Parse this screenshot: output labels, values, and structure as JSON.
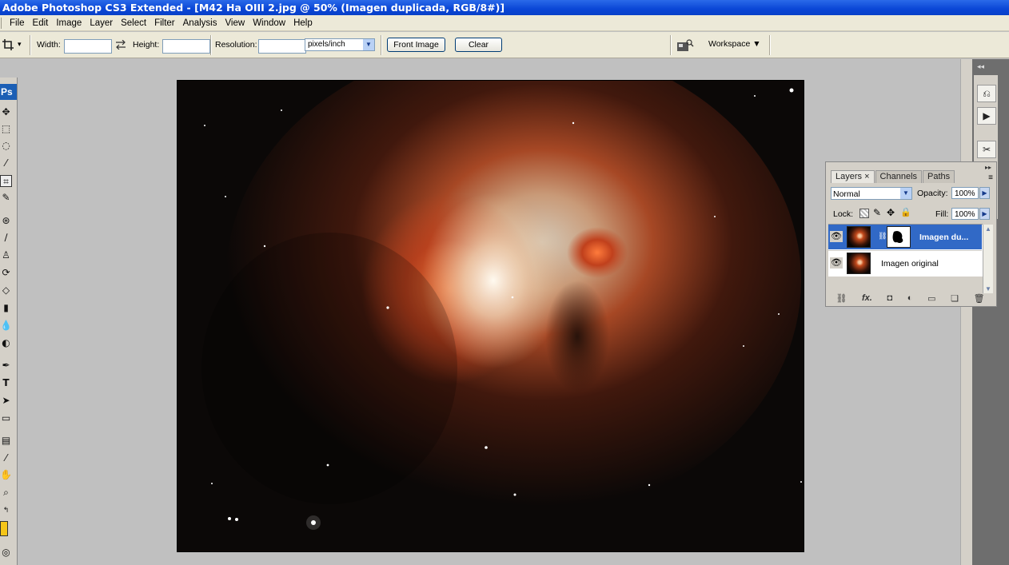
{
  "window": {
    "title": "Adobe Photoshop CS3 Extended - [M42  Ha OIII 2.jpg @ 50% (Imagen duplicada, RGB/8#)]"
  },
  "menu": [
    "File",
    "Edit",
    "Image",
    "Layer",
    "Select",
    "Filter",
    "Analysis",
    "View",
    "Window",
    "Help"
  ],
  "options": {
    "width_label": "Width:",
    "width_value": "",
    "swap_icon": "swap-arrows-icon",
    "height_label": "Height:",
    "height_value": "",
    "resolution_label": "Resolution:",
    "resolution_value": "",
    "resolution_unit": "pixels/inch",
    "front_image_label": "Front Image",
    "clear_label": "Clear",
    "workspace_label": "Workspace ▼"
  },
  "toolbox": {
    "logo": "Ps",
    "tools": [
      "move",
      "marquee",
      "lasso",
      "magic-wand",
      "crop",
      "slice",
      "healing",
      "brush",
      "clone-stamp",
      "history-brush",
      "eraser",
      "gradient",
      "blur",
      "dodge",
      "pen",
      "type",
      "path-select",
      "shape",
      "notes",
      "eyedropper",
      "hand",
      "zoom",
      "swap-colors",
      "foreground-color",
      "quick-mask"
    ],
    "foreground_color": "#f5c518"
  },
  "layers_panel": {
    "tabs": [
      "Layers",
      "Channels",
      "Paths"
    ],
    "tab_close": "×",
    "blend_mode": "Normal",
    "opacity_label": "Opacity:",
    "opacity_value": "100%",
    "lock_label": "Lock:",
    "fill_label": "Fill:",
    "fill_value": "100%",
    "layers": [
      {
        "name": "Imagen du...",
        "selected": true,
        "has_mask": true
      },
      {
        "name": "Imagen original",
        "selected": false,
        "has_mask": false
      }
    ],
    "footer_icons": [
      "link-icon",
      "fx-icon",
      "mask-icon",
      "adjustment-icon",
      "folder-icon",
      "new-layer-icon",
      "trash-icon"
    ],
    "fx_label": "fx."
  },
  "colors": {
    "titlebar": "#0a46d6",
    "selected_layer": "#3169c6",
    "chrome": "#ece9d8"
  }
}
